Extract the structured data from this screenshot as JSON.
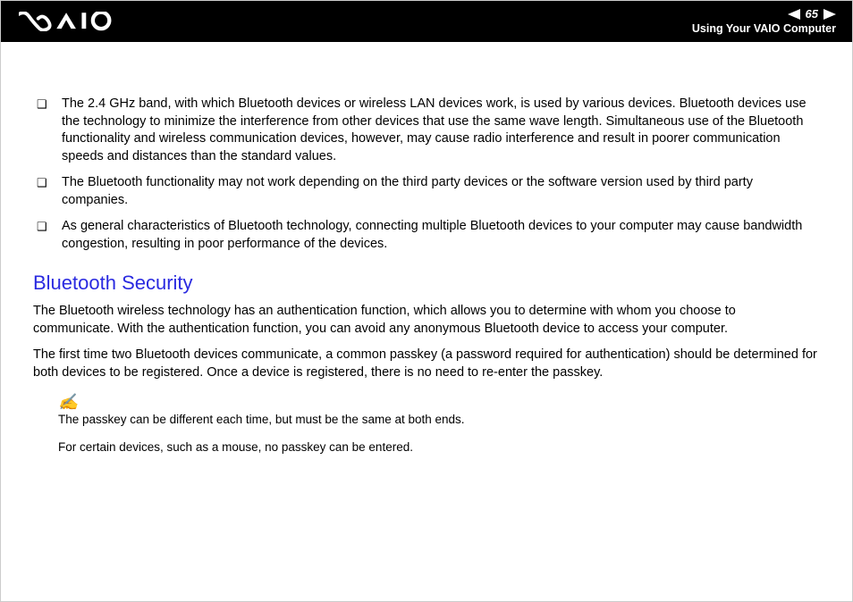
{
  "header": {
    "page_number": "65",
    "breadcrumb": "Using Your VAIO Computer"
  },
  "bullets": [
    "The 2.4 GHz band, with which Bluetooth devices or wireless LAN devices work, is used by various devices. Bluetooth devices use the technology to minimize the interference from other devices that use the same wave length. Simultaneous use of the Bluetooth functionality and wireless communication devices, however, may cause radio interference and result in poorer communication speeds and distances than the standard values.",
    "The Bluetooth functionality may not work depending on the third party devices or the software version used by third party companies.",
    "As general characteristics of Bluetooth technology, connecting multiple Bluetooth devices to your computer may cause bandwidth congestion, resulting in poor performance of the devices."
  ],
  "section": {
    "title": "Bluetooth Security",
    "para1": "The Bluetooth wireless technology has an authentication function, which allows you to determine with whom you choose to communicate. With the authentication function, you can avoid any anonymous Bluetooth device to access your computer.",
    "para2": "The first time two Bluetooth devices communicate, a common passkey (a password required for authentication) should be determined for both devices to be registered. Once a device is registered, there is no need to re-enter the passkey."
  },
  "note": {
    "line1": "The passkey can be different each time, but must be the same at both ends.",
    "line2": "For certain devices, such as a mouse, no passkey can be entered."
  }
}
